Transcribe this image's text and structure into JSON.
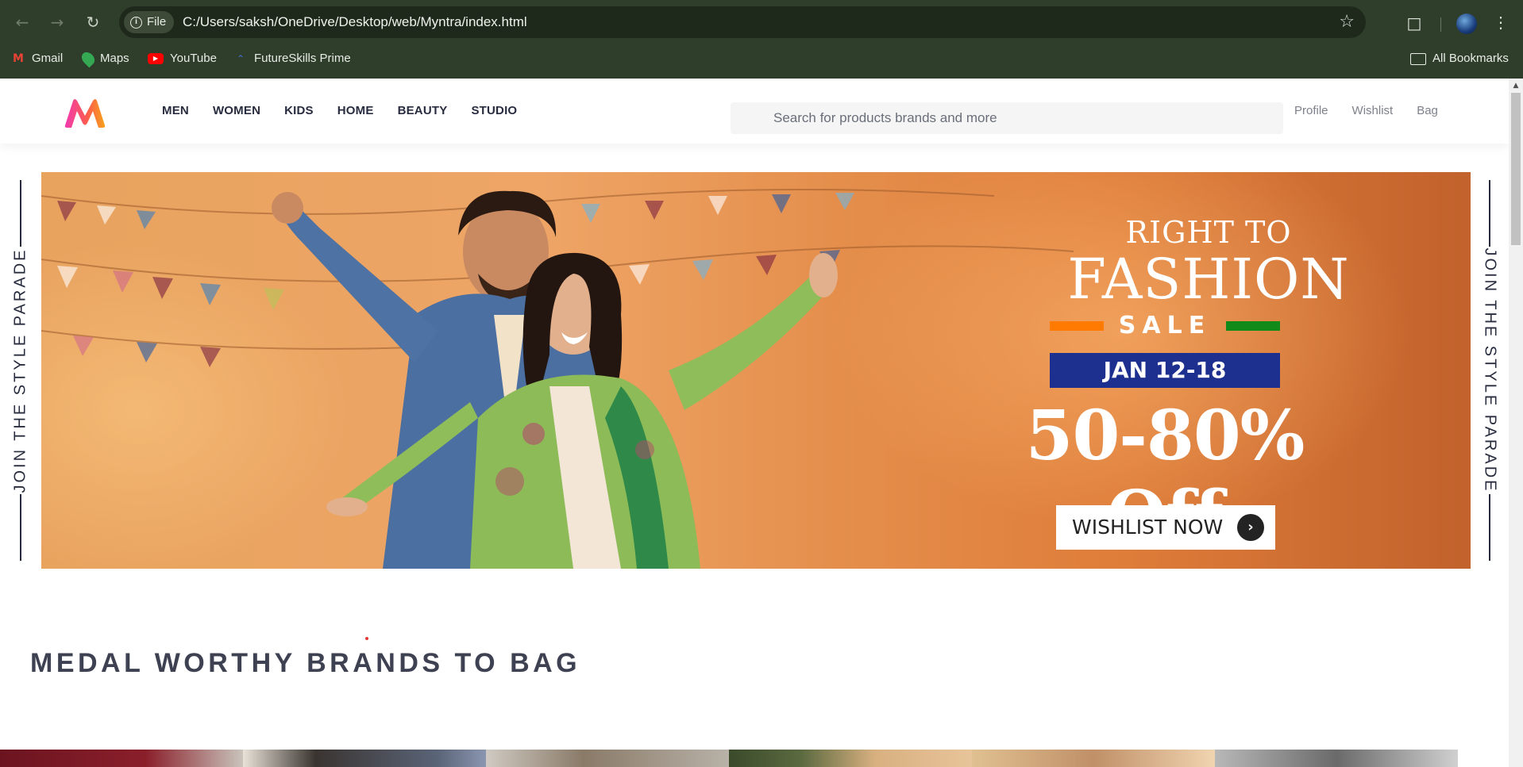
{
  "browser": {
    "file_chip": "File",
    "url": "C:/Users/saksh/OneDrive/Desktop/web/Myntra/index.html",
    "bookmarks": [
      {
        "label": "Gmail",
        "icon": "gmail-icon"
      },
      {
        "label": "Maps",
        "icon": "maps-icon"
      },
      {
        "label": "YouTube",
        "icon": "youtube-icon"
      },
      {
        "label": "FutureSkills Prime",
        "icon": "futureskills-icon"
      }
    ],
    "all_bookmarks": "All Bookmarks"
  },
  "header": {
    "nav": [
      "MEN",
      "WOMEN",
      "KIDS",
      "HOME",
      "BEAUTY",
      "STUDIO"
    ],
    "search_placeholder": "Search for products brands and more",
    "actions": [
      "Profile",
      "Wishlist",
      "Bag"
    ]
  },
  "banner": {
    "side_text": "JOIN THE STYLE PARADE",
    "line1": "RIGHT TO",
    "line2": "FASHION",
    "sale": "SALE",
    "dates": "JAN 12-18",
    "offer": "50-80% Off",
    "cta": "WISHLIST NOW"
  },
  "section": {
    "title": "MEDAL WORTHY BRANDS TO BAG"
  },
  "colors": {
    "brand_pink": "#ff3f6c",
    "brand_orange": "#f26a10",
    "chrome_bg": "#2f3d2b",
    "date_box": "#1d2f8f",
    "text_dark": "#282c3f"
  }
}
